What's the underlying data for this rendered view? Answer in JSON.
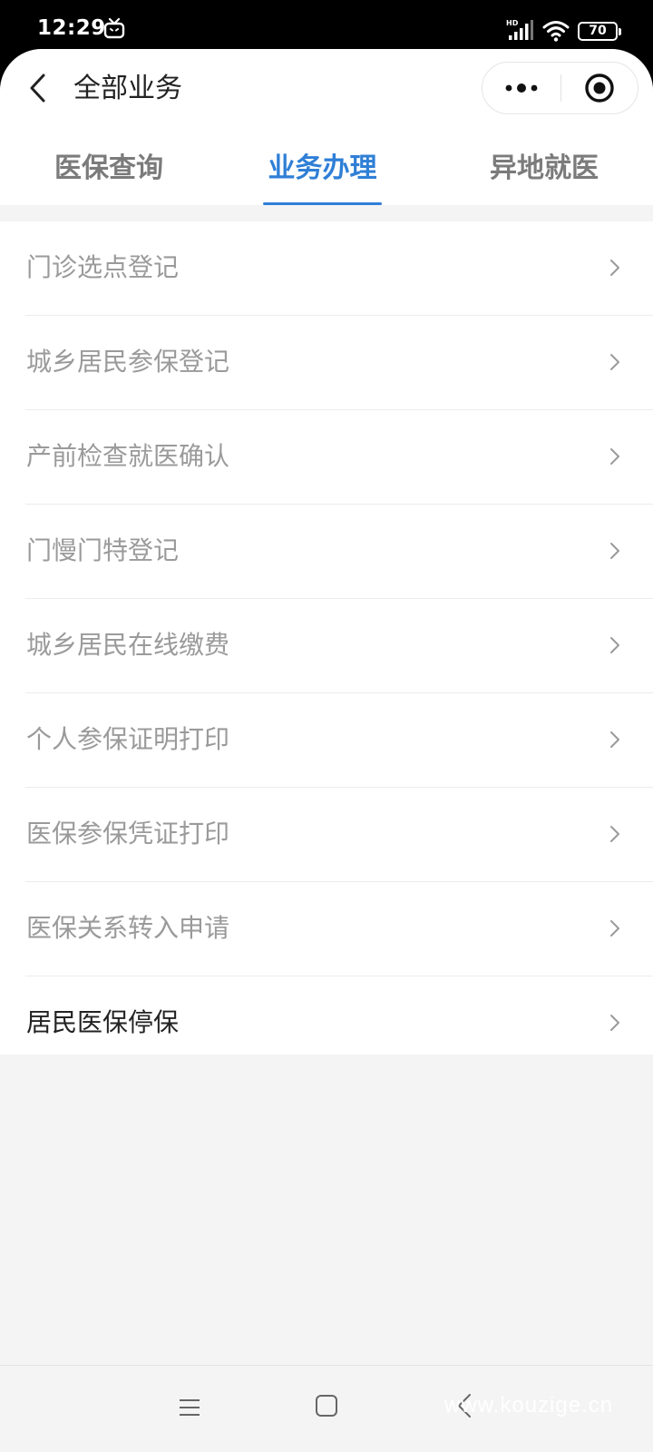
{
  "status_bar": {
    "time": "12:29",
    "network_label": "HD",
    "battery": "70",
    "icons": [
      "tv-icon",
      "signal-icon",
      "wifi-icon",
      "battery-icon"
    ]
  },
  "header": {
    "title": "全部业务",
    "back_icon": "chevron-left-icon",
    "more_icon": "more-dots-icon",
    "close_icon": "target-close-icon"
  },
  "tabs": [
    {
      "label": "医保查询",
      "active": false
    },
    {
      "label": "业务办理",
      "active": true
    },
    {
      "label": "异地就医",
      "active": false
    }
  ],
  "services": [
    {
      "label": "门诊选点登记",
      "dimmed": true
    },
    {
      "label": "城乡居民参保登记",
      "dimmed": true
    },
    {
      "label": "产前检查就医确认",
      "dimmed": true
    },
    {
      "label": "门慢门特登记",
      "dimmed": true
    },
    {
      "label": "城乡居民在线缴费",
      "dimmed": true
    },
    {
      "label": "个人参保证明打印",
      "dimmed": true
    },
    {
      "label": "医保参保凭证打印",
      "dimmed": true
    },
    {
      "label": "医保关系转入申请",
      "dimmed": true
    },
    {
      "label": "居民医保停保",
      "dimmed": false
    }
  ],
  "nav_bar": {
    "icons": [
      "menu-icon",
      "home-icon",
      "back-icon"
    ],
    "watermark": "www.kouzige.cn"
  },
  "colors": {
    "accent": "#2f7fd6",
    "dim_text": "#9a9a9a",
    "dark_text": "#222222"
  }
}
